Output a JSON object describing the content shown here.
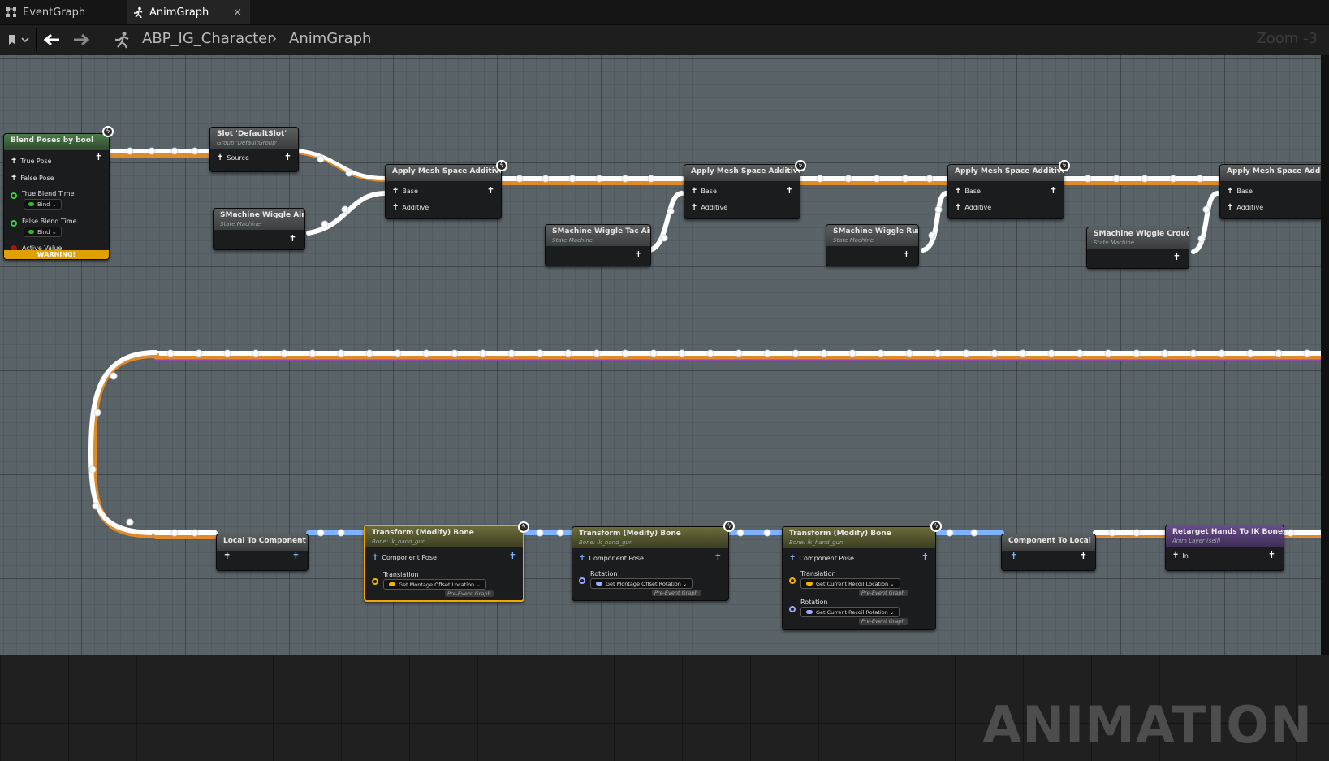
{
  "tabs": [
    {
      "label": "EventGraph",
      "icon": "graph-icon"
    },
    {
      "label": "AnimGraph",
      "icon": "running-man-icon",
      "close": "×"
    }
  ],
  "breadcrumb": {
    "asset": "ABP_IG_Character",
    "separator": "›",
    "graph": "AnimGraph"
  },
  "zoom": "Zoom -3",
  "watermark": "ANIMATION",
  "nodes": {
    "blend": {
      "title": "Blend Poses by bool",
      "true_pose": "True Pose",
      "false_pose": "False Pose",
      "true_blend": "True Blend Time",
      "false_blend": "False Blend Time",
      "bind": "Bind ⌄",
      "active": "Active Value",
      "warning": "WARNING!"
    },
    "slot": {
      "title": "Slot 'DefaultSlot'",
      "sub": "Group 'DefaultGroup'",
      "source": "Source"
    },
    "wiggle_aim": {
      "title": "SMachine Wiggle Aim",
      "sub": "State Machine"
    },
    "apply1": {
      "title": "Apply Mesh Space Additive",
      "base": "Base",
      "additive": "Additive"
    },
    "apply2": {
      "title": "Apply Mesh Space Additive",
      "base": "Base",
      "additive": "Additive"
    },
    "apply3": {
      "title": "Apply Mesh Space Additive",
      "base": "Base",
      "additive": "Additive"
    },
    "apply4": {
      "title": "Apply Mesh Space Additive",
      "base": "Base",
      "additive": "Additive"
    },
    "wiggle_tac": {
      "title": "SMachine Wiggle Tac Aim",
      "sub": "State Machine"
    },
    "wiggle_run": {
      "title": "SMachine Wiggle Run",
      "sub": "State Machine"
    },
    "wiggle_crouch": {
      "title": "SMachine Wiggle Crouch",
      "sub": "State Machine"
    },
    "l2c": {
      "title": "Local To Component"
    },
    "tmb1": {
      "title": "Transform (Modify) Bone",
      "sub": "Bone: ik_hand_gun",
      "pose": "Component Pose",
      "param": "Translation",
      "get": "Get Montage Offset Location ⌄",
      "tag": "Pre-Event Graph"
    },
    "tmb2": {
      "title": "Transform (Modify) Bone",
      "sub": "Bone: ik_hand_gun",
      "pose": "Component Pose",
      "param": "Rotation",
      "get": "Get Montage Offset Rotation ⌄",
      "tag": "Pre-Event Graph"
    },
    "tmb3": {
      "title": "Transform (Modify) Bone",
      "sub": "Bone: ik_hand_gun",
      "pose": "Component Pose",
      "param1": "Translation",
      "get1": "Get Current Recoil Location ⌄",
      "tag1": "Pre-Event Graph",
      "param2": "Rotation",
      "get2": "Get Current Recoil Rotation ⌄",
      "tag2": "Pre-Event Graph"
    },
    "c2l": {
      "title": "Component To Local"
    },
    "retarget": {
      "title": "Retarget Hands To IK Bones",
      "sub": "Anim Layer (self)",
      "in": "In"
    }
  },
  "colors": {
    "canvas": "#596368",
    "pose_wire": "#ffffff",
    "component_wire": "#7fb3ff",
    "warning": "#e0a000",
    "selected": "#f3a600"
  }
}
